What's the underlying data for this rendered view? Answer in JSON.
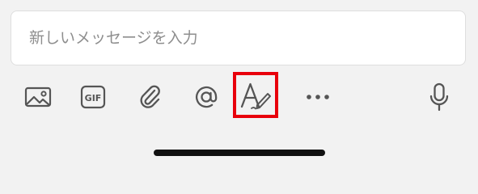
{
  "composer": {
    "placeholder": "新しいメッセージを入力"
  },
  "toolbar": {
    "items": [
      {
        "icon": "image-icon"
      },
      {
        "icon": "gif-icon",
        "label": "GIF"
      },
      {
        "icon": "paperclip-icon"
      },
      {
        "icon": "at-mention-icon"
      },
      {
        "icon": "text-format-icon",
        "highlighted": true
      },
      {
        "icon": "more-options-icon"
      },
      {
        "icon": "microphone-icon"
      }
    ]
  },
  "colors": {
    "background": "#f2f2f2",
    "input_background": "#ffffff",
    "icon": "#555555",
    "highlight": "#e8000b",
    "home_indicator": "#111111"
  }
}
